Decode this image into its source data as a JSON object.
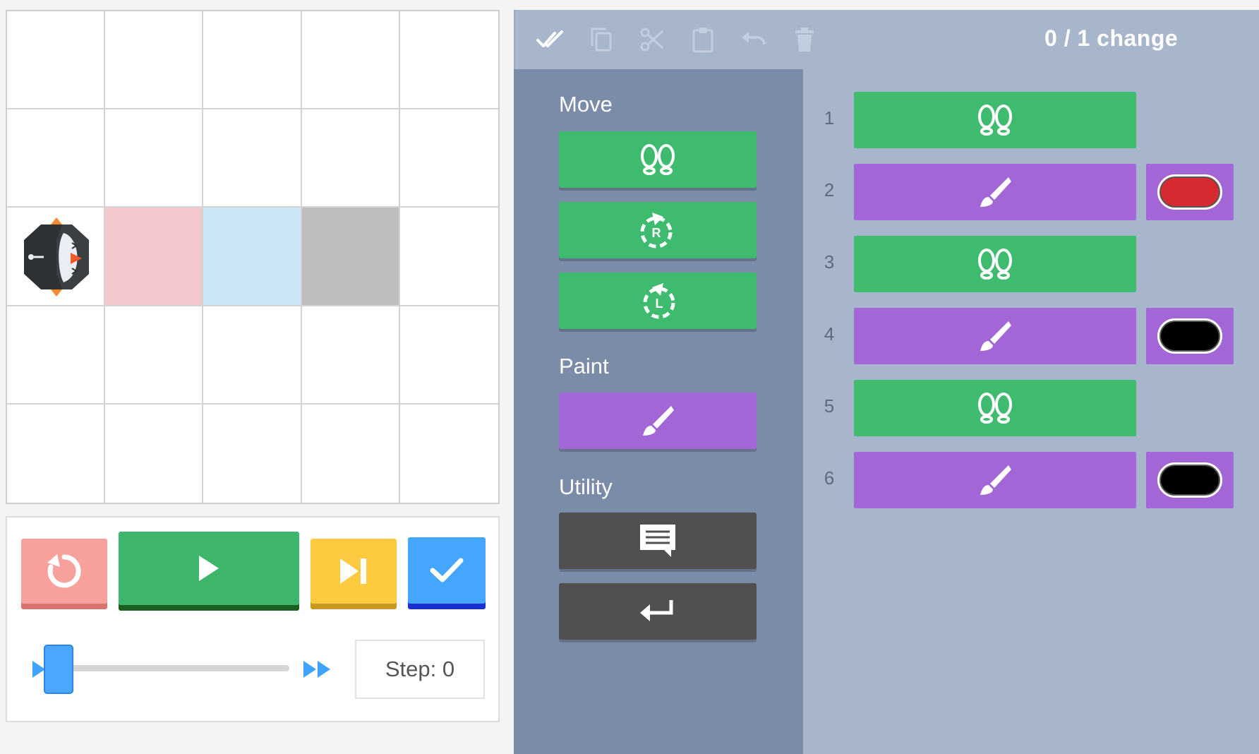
{
  "grid": {
    "rows": 5,
    "cols": 5,
    "painted_cells": [
      {
        "row": 3,
        "col": 2,
        "color": "#f3c9ce"
      },
      {
        "row": 3,
        "col": 3,
        "color": "#cde6f6"
      },
      {
        "row": 3,
        "col": 4,
        "color": "#bdbdbd"
      }
    ],
    "robot": {
      "row": 3,
      "col": 1,
      "facing": "right",
      "icon": "puffin-robot-icon"
    }
  },
  "controls": {
    "reset_icon": "reset-icon",
    "run_icon": "play-icon",
    "step_icon": "step-forward-icon",
    "check_icon": "check-icon",
    "speed_slider": {
      "value": 0,
      "start_icon": "slow-icon",
      "end_icon": "fast-forward-icon"
    },
    "step_label": "Step: 0"
  },
  "toolbar": {
    "tools": [
      "select-all-icon",
      "copy-icon",
      "cut-icon",
      "paste-icon",
      "undo-icon",
      "delete-icon"
    ],
    "changes_label": "0 / 1 change"
  },
  "toolbox": {
    "categories": [
      {
        "label": "Move",
        "blocks": [
          "footsteps-icon",
          "rotate-right-icon",
          "rotate-left-icon"
        ]
      },
      {
        "label": "Paint",
        "blocks": [
          "paintbrush-icon"
        ]
      },
      {
        "label": "Utility",
        "blocks": [
          "comment-icon",
          "return-icon"
        ]
      }
    ],
    "turn_labels": {
      "right": "R",
      "left": "L"
    }
  },
  "program": {
    "rows": [
      {
        "num": "1",
        "type": "move",
        "icon": "footsteps-icon"
      },
      {
        "num": "2",
        "type": "paint",
        "icon": "paintbrush-icon",
        "color": "#d62a30"
      },
      {
        "num": "3",
        "type": "move",
        "icon": "footsteps-icon"
      },
      {
        "num": "4",
        "type": "paint",
        "icon": "paintbrush-icon",
        "color": "#000000"
      },
      {
        "num": "5",
        "type": "move",
        "icon": "footsteps-icon"
      },
      {
        "num": "6",
        "type": "paint",
        "icon": "paintbrush-icon",
        "color": "#000000"
      }
    ]
  },
  "colors": {
    "move": "#3ebb6e",
    "paint": "#a266d6",
    "utility": "#505050",
    "toolbox_bg": "#7b8ca9",
    "workspace_bg": "#a8b6cc"
  }
}
